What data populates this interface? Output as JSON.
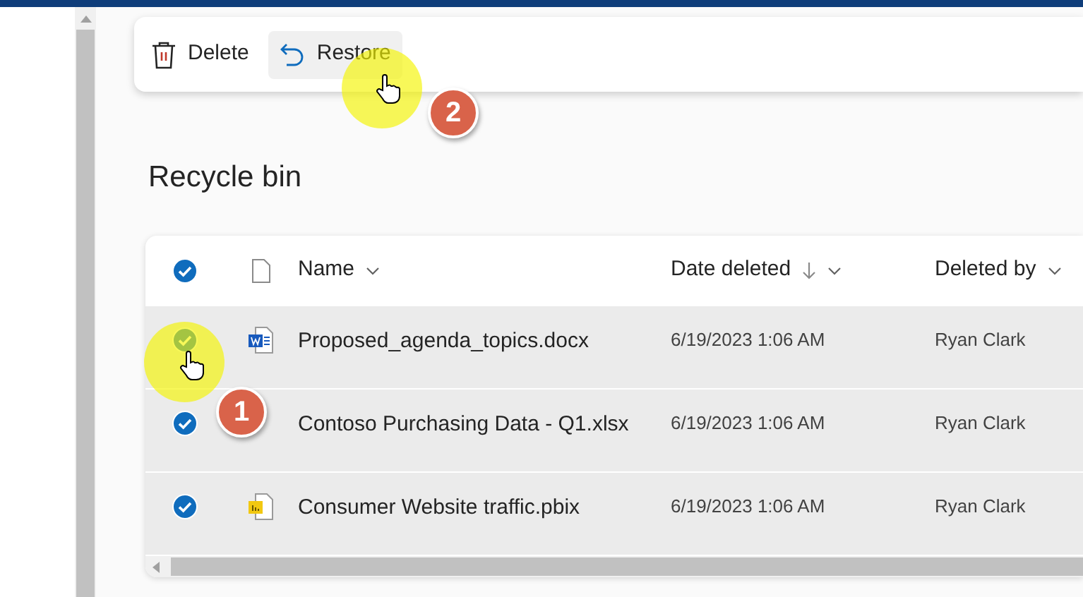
{
  "toolbar": {
    "buttons": [
      {
        "kind": "delete",
        "label": "Delete",
        "highlighted": false
      },
      {
        "kind": "restore",
        "label": "Restore",
        "highlighted": true
      }
    ]
  },
  "heading": "Recycle bin",
  "table": {
    "all_selected": true,
    "columns": [
      {
        "label": "Name",
        "sorted": false
      },
      {
        "label": "Date deleted",
        "sorted": true
      },
      {
        "label": "Deleted by",
        "sorted": false
      }
    ],
    "rows": [
      {
        "selected": true,
        "kind": "word",
        "name": "Proposed_agenda_topics.docx",
        "date_deleted": "6/19/2023 1:06 AM",
        "deleted_by": "Ryan Clark"
      },
      {
        "selected": true,
        "name": "Contoso Purchasing Data - Q1.xlsx",
        "date_deleted": "6/19/2023 1:06 AM",
        "deleted_by": "Ryan Clark"
      },
      {
        "selected": true,
        "kind": "powerbi",
        "name": "Consumer Website traffic.pbix",
        "date_deleted": "6/19/2023 1:06 AM",
        "deleted_by": "Ryan Clark"
      }
    ]
  },
  "callouts": [
    "1",
    "2"
  ]
}
